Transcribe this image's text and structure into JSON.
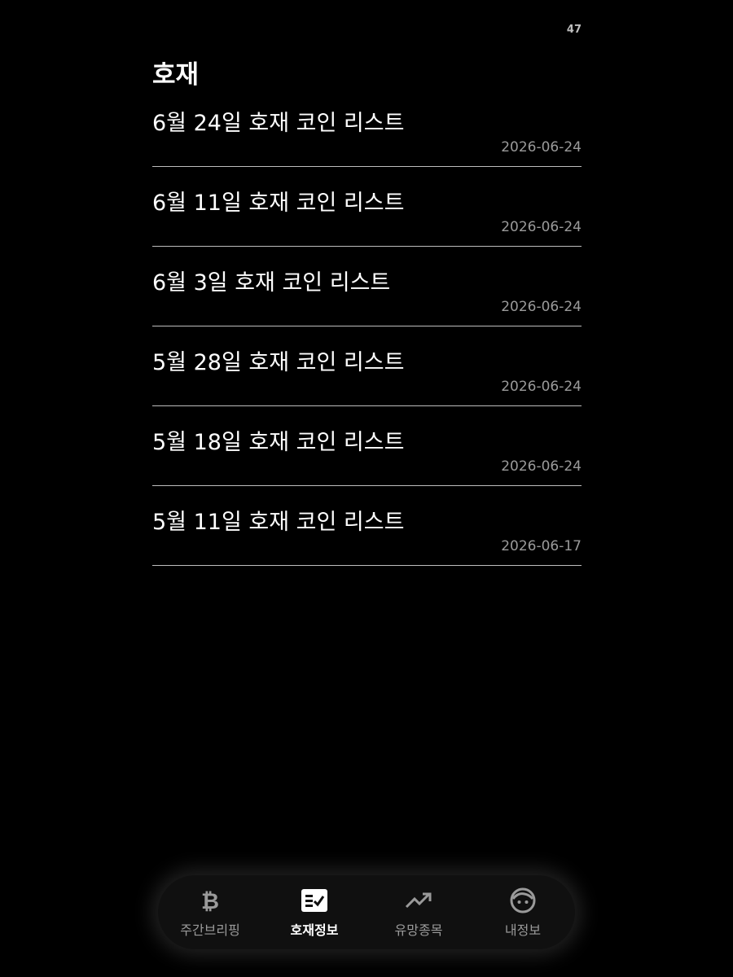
{
  "status": {
    "number": "47"
  },
  "page": {
    "title": "호재"
  },
  "news": [
    {
      "title": "6월 24일 호재 코인 리스트",
      "date": "2026-06-24"
    },
    {
      "title": "6월 11일 호재 코인 리스트",
      "date": "2026-06-24"
    },
    {
      "title": "6월 3일 호재 코인 리스트",
      "date": "2026-06-24"
    },
    {
      "title": "5월 28일 호재 코인 리스트",
      "date": "2026-06-24"
    },
    {
      "title": "5월 18일 호재 코인 리스트",
      "date": "2026-06-24"
    },
    {
      "title": "5월 11일 호재 코인 리스트",
      "date": "2026-06-17"
    }
  ],
  "nav": {
    "items": [
      {
        "label": "주간브리핑",
        "icon": "bitcoin-icon",
        "active": false
      },
      {
        "label": "호재정보",
        "icon": "checklist-icon",
        "active": true
      },
      {
        "label": "유망종목",
        "icon": "trending-up-icon",
        "active": false
      },
      {
        "label": "내정보",
        "icon": "face-icon",
        "active": false
      }
    ]
  },
  "colors": {
    "background": "#000000",
    "text_primary": "#ffffff",
    "text_secondary": "#9a9a9a",
    "divider": "#bdbdbd",
    "nav_background": "#101010"
  }
}
